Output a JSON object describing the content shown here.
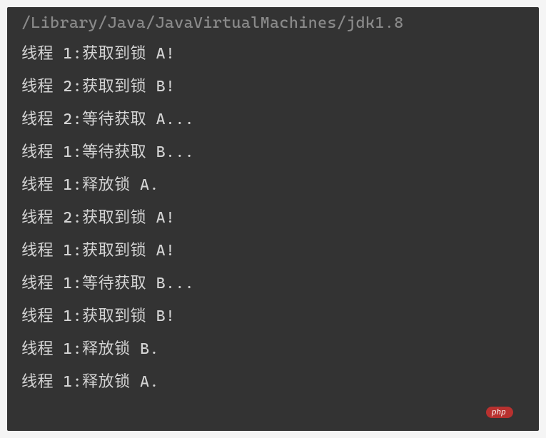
{
  "terminal": {
    "path": "/Library/Java/JavaVirtualMachines/jdk1.8",
    "lines": [
      "线程 1:获取到锁 A!",
      "线程 2:获取到锁 B!",
      "线程 2:等待获取 A...",
      "线程 1:等待获取 B...",
      "线程 1:释放锁 A.",
      "线程 2:获取到锁 A!",
      "线程 1:获取到锁 A!",
      "线程 1:等待获取 B...",
      "线程 1:获取到锁 B!",
      "线程 1:释放锁 B.",
      "线程 1:释放锁 A."
    ]
  },
  "watermark": {
    "badge": "php",
    "suffix": ""
  }
}
